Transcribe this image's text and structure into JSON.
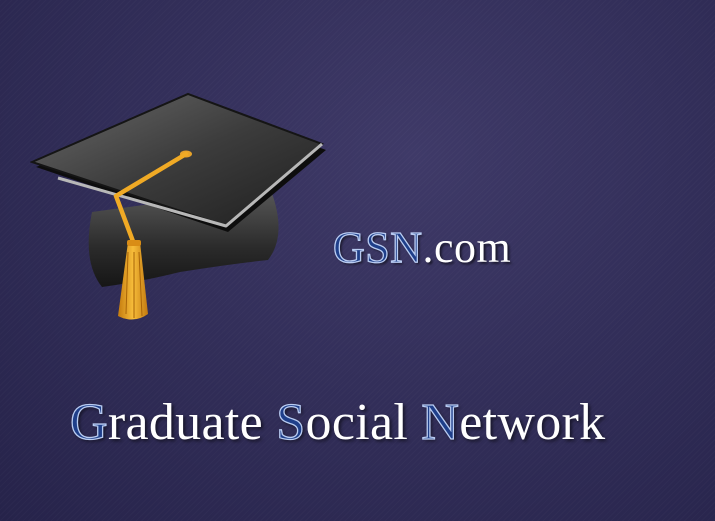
{
  "logo": {
    "icon": "graduation-cap-icon",
    "accent_color": "#1f3f8a",
    "tassel_color": "#f2a81e"
  },
  "brand": {
    "letters": "GSN",
    "suffix": ".com"
  },
  "tagline": {
    "words": [
      {
        "initial": "G",
        "rest": "raduate"
      },
      {
        "initial": "S",
        "rest": "ocial"
      },
      {
        "initial": "N",
        "rest": "etwork"
      }
    ]
  }
}
